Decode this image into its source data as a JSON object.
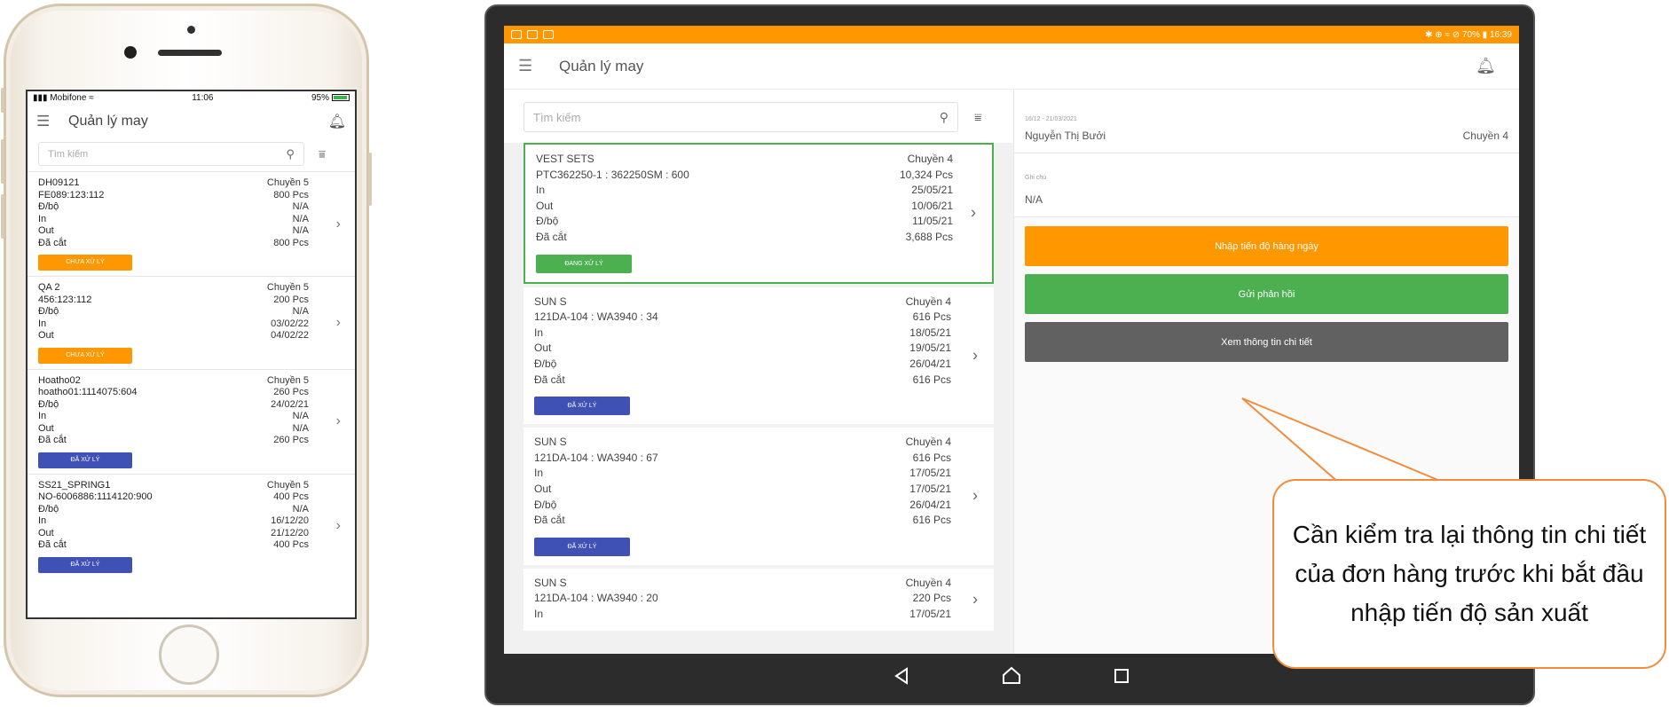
{
  "phone": {
    "status": {
      "carrier": "Mobifone",
      "time": "11:06",
      "battery": "95%"
    },
    "app_title": "Quản lý may",
    "search_placeholder": "Tìm kiếm",
    "orders": [
      {
        "rows": [
          [
            "DH09121",
            "Chuyền 5"
          ],
          [
            "FE089:123:112",
            "800 Pcs"
          ],
          [
            "Đ/bộ",
            "N/A"
          ],
          [
            "In",
            "N/A"
          ],
          [
            "Out",
            "N/A"
          ],
          [
            "Đã cắt",
            "800 Pcs"
          ]
        ],
        "badge": "CHƯA XỬ LÝ",
        "color": "#ff9800"
      },
      {
        "rows": [
          [
            "QA 2",
            "Chuyền 5"
          ],
          [
            "456:123:112",
            "200 Pcs"
          ],
          [
            "Đ/bộ",
            "N/A"
          ],
          [
            "In",
            "03/02/22"
          ],
          [
            "Out",
            "04/02/22"
          ]
        ],
        "badge": "CHƯA XỬ LÝ",
        "color": "#ff9800"
      },
      {
        "rows": [
          [
            "Hoatho02",
            "Chuyền 5"
          ],
          [
            "hoatho01:1114075:604",
            "260 Pcs"
          ],
          [
            "Đ/bộ",
            "24/02/21"
          ],
          [
            "In",
            "N/A"
          ],
          [
            "Out",
            "N/A"
          ],
          [
            "Đã cắt",
            "260 Pcs"
          ]
        ],
        "badge": "ĐÃ XỬ LÝ",
        "color": "#3f51b5"
      },
      {
        "rows": [
          [
            "SS21_SPRING1",
            "Chuyền 5"
          ],
          [
            "NO-6006886:1114120:900",
            "400 Pcs"
          ],
          [
            "Đ/bộ",
            "N/A"
          ],
          [
            "In",
            "16/12/20"
          ],
          [
            "Out",
            "21/12/20"
          ],
          [
            "Đã cắt",
            "400 Pcs"
          ]
        ],
        "badge": "ĐÃ XỬ LÝ",
        "color": "#3f51b5"
      }
    ]
  },
  "tablet": {
    "status": {
      "battery": "70%",
      "time": "16:39"
    },
    "app_title": "Quản lý may",
    "search_placeholder": "Tìm kiếm",
    "orders": [
      {
        "rows": [
          [
            "VEST SETS",
            "Chuyền 4"
          ],
          [
            "PTC362250-1 : 362250SM : 600",
            "10,324 Pcs"
          ],
          [
            "In",
            "25/05/21"
          ],
          [
            "Out",
            "10/06/21"
          ],
          [
            "Đ/bộ",
            "11/05/21"
          ],
          [
            "Đã cắt",
            "3,688 Pcs"
          ]
        ],
        "badge": "ĐANG XỬ LÝ",
        "color": "#4caf50",
        "selected": true
      },
      {
        "rows": [
          [
            "SUN S",
            "Chuyền 4"
          ],
          [
            "121DA-104 : WA3940 : 34",
            "616 Pcs"
          ],
          [
            "In",
            "18/05/21"
          ],
          [
            "Out",
            "19/05/21"
          ],
          [
            "Đ/bộ",
            "26/04/21"
          ],
          [
            "Đã cắt",
            "616 Pcs"
          ]
        ],
        "badge": "ĐÃ XỬ LÝ",
        "color": "#3f51b5"
      },
      {
        "rows": [
          [
            "SUN S",
            "Chuyền 4"
          ],
          [
            "121DA-104 : WA3940 : 67",
            "616 Pcs"
          ],
          [
            "In",
            "17/05/21"
          ],
          [
            "Out",
            "17/05/21"
          ],
          [
            "Đ/bộ",
            "26/04/21"
          ],
          [
            "Đã cắt",
            "616 Pcs"
          ]
        ],
        "badge": "ĐÃ XỬ LÝ",
        "color": "#3f51b5"
      },
      {
        "rows": [
          [
            "SUN S",
            "Chuyền 4"
          ],
          [
            "121DA-104 : WA3940 : 20",
            "220 Pcs"
          ],
          [
            "In",
            "17/05/21"
          ]
        ],
        "badge": "",
        "color": "#3f51b5"
      }
    ],
    "detail": {
      "date_range": "16/12 - 21/03/2021",
      "person": "Nguyễn Thị Bưởi",
      "line": "Chuyền 4",
      "note_label": "Ghi chú",
      "note_value": "N/A",
      "buttons": {
        "progress": "Nhập tiến độ hàng ngày",
        "feedback": "Gửi phản hồi",
        "details": "Xem thông tin chi tiết"
      }
    }
  },
  "callout": {
    "text": "Cần kiểm tra lại thông tin chi tiết của đơn hàng trước khi bắt đầu nhập tiến độ sản xuất"
  },
  "colors": {
    "accent": "#ff9800",
    "success": "#4caf50",
    "primary": "#3f51b5",
    "neutral": "#616161",
    "callout_border": "#f08c3c"
  },
  "icons": [
    "menu-icon",
    "bell-icon",
    "search-icon",
    "filter-icon",
    "chevron-right-icon",
    "back-icon",
    "home-icon",
    "recents-icon"
  ]
}
